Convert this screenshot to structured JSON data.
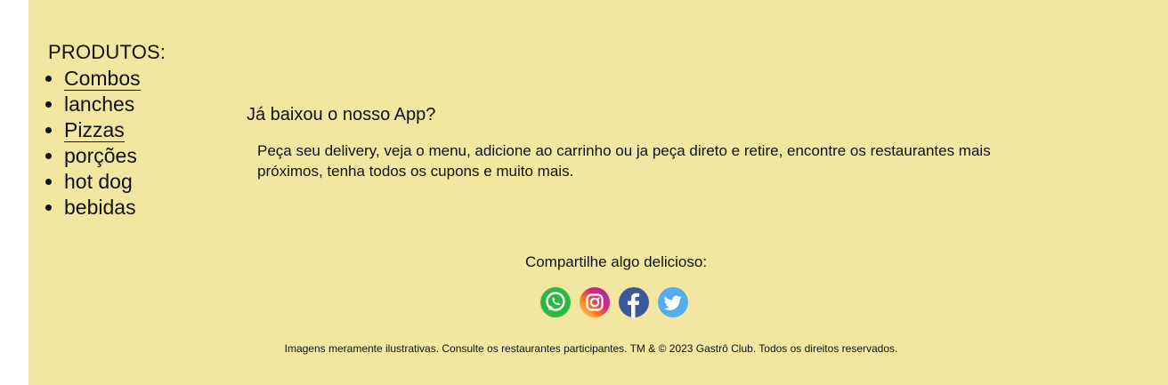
{
  "products": {
    "title": "PRODUTOS:",
    "items": [
      {
        "label": "Combos",
        "icon": "link"
      },
      {
        "label": "lanches",
        "icon": "text"
      },
      {
        "label": "Pizzas",
        "icon": "link"
      },
      {
        "label": "porções",
        "icon": "text"
      },
      {
        "label": "hot dog",
        "icon": "text"
      },
      {
        "label": "bebidas",
        "icon": "text"
      }
    ]
  },
  "app_promo": {
    "title": "Já baixou o nosso App?",
    "text": "Peça seu delivery, veja o menu, adicione ao carrinho ou ja peça direto e retire, encontre os restaurantes mais próximos, tenha todos os cupons e muito mais."
  },
  "share": {
    "title": "Compartilhe algo delicioso:",
    "icons": [
      "whatsapp-icon",
      "instagram-icon",
      "facebook-icon",
      "twitter-icon"
    ]
  },
  "copyright": "Imagens meramente ilustrativas. Consulte os restaurantes participantes. TM & © 2023  Gastrô Club. Todos os direitos reservados.",
  "colors": {
    "footer_background": "#f2e6a0",
    "whatsapp": "#2db742",
    "facebook": "#3b5998",
    "twitter": "#55acee",
    "instagram_start": "#feda75",
    "instagram_end": "#962fbf"
  }
}
